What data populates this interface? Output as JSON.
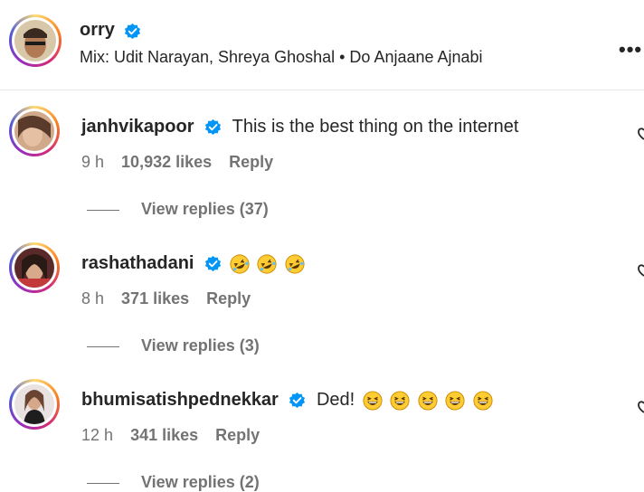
{
  "post": {
    "author": "orry",
    "audio": "Mix: Udit Narayan, Shreya Ghoshal • Do Anjaane Ajnabi",
    "more_icon": "more-horizontal-icon"
  },
  "comments": [
    {
      "username": "janhvikapoor",
      "verified": true,
      "text": "This is the best thing on the internet",
      "emojis": [],
      "time": "9 h",
      "likes": "10,932 likes",
      "reply": "Reply",
      "view_replies": "View replies (37)"
    },
    {
      "username": "rashathadani",
      "verified": true,
      "text": "",
      "emojis": [
        "rolling-laughing",
        "rolling-laughing",
        "rolling-laughing"
      ],
      "time": "8 h",
      "likes": "371 likes",
      "reply": "Reply",
      "view_replies": "View replies (3)"
    },
    {
      "username": "bhumisatishpednekkar",
      "verified": true,
      "text": "Ded!",
      "emojis": [
        "grinning-squint",
        "grinning-squint",
        "grinning-squint",
        "grinning-squint",
        "grinning-squint"
      ],
      "time": "12 h",
      "likes": "341 likes",
      "reply": "Reply",
      "view_replies": "View replies (2)"
    }
  ],
  "colors": {
    "verified": "#0095f6",
    "secondary_text": "#737373",
    "primary_text": "#262626"
  }
}
